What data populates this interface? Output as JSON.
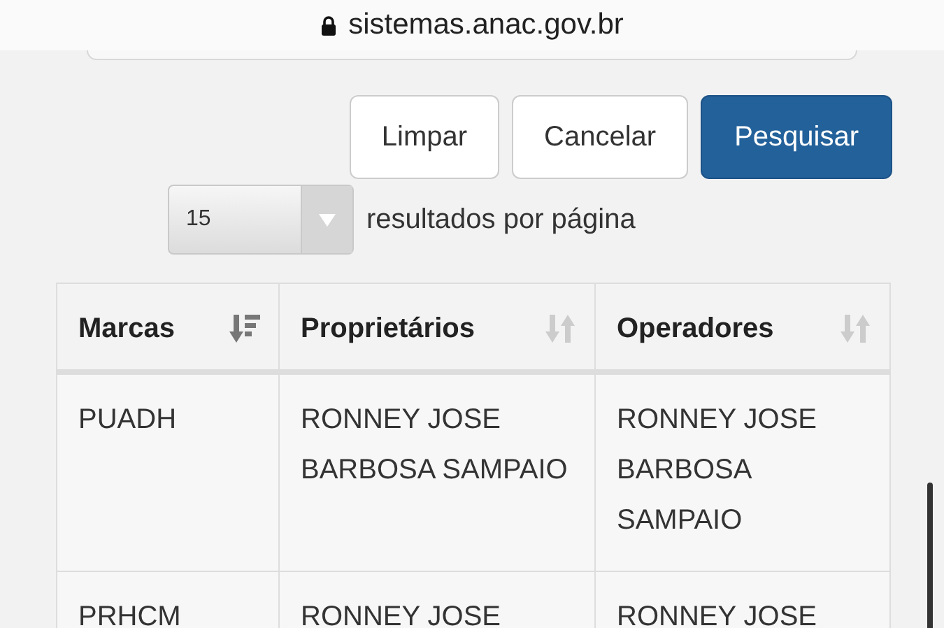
{
  "address_bar": {
    "url": "sistemas.anac.gov.br",
    "secure": true
  },
  "buttons": [
    {
      "label": "Limpar",
      "kind": "default"
    },
    {
      "label": "Cancelar",
      "kind": "default"
    },
    {
      "label": "Pesquisar",
      "kind": "primary"
    }
  ],
  "page_size": {
    "value": "15",
    "label": "resultados por página"
  },
  "table": {
    "columns": [
      {
        "label": "Marcas",
        "sorted": true
      },
      {
        "label": "Proprietários",
        "sorted": false
      },
      {
        "label": "Operadores",
        "sorted": false
      }
    ],
    "rows": [
      [
        "PUADH",
        "RONNEY JOSE BARBOSA SAMPAIO",
        "RONNEY JOSE BARBOSA SAMPAIO"
      ],
      [
        "PRHCM",
        "RONNEY JOSE",
        "RONNEY JOSE"
      ]
    ]
  }
}
